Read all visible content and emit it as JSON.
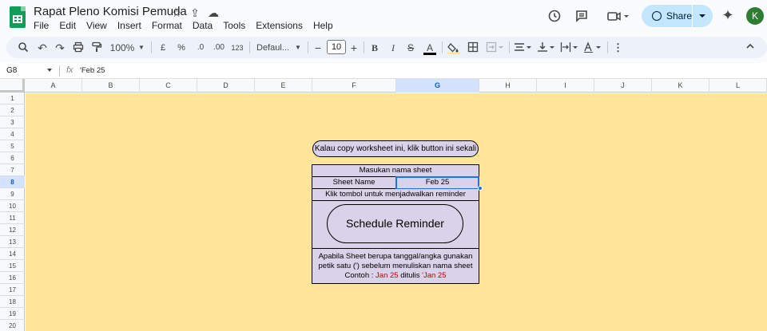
{
  "doc": {
    "title": "Rapat Pleno Komisi Pemuda"
  },
  "menu": [
    "File",
    "Edit",
    "View",
    "Insert",
    "Format",
    "Data",
    "Tools",
    "Extensions",
    "Help"
  ],
  "header": {
    "share_label": "Share",
    "avatar_initial": "K"
  },
  "toolbar": {
    "zoom": "100%",
    "currency": "£",
    "percent": "%",
    "dec_decrease": ".0",
    "dec_increase": ".00",
    "number_format": "123",
    "font": "Defaul...",
    "font_size": "10"
  },
  "formula_bar": {
    "cell_ref": "G8",
    "content": "'Feb 25"
  },
  "columns": [
    "A",
    "B",
    "C",
    "D",
    "E",
    "F",
    "G",
    "H",
    "I",
    "J",
    "K",
    "L"
  ],
  "rows": [
    "1",
    "2",
    "3",
    "4",
    "5",
    "6",
    "7",
    "8",
    "9",
    "10",
    "11",
    "12",
    "13",
    "14",
    "15",
    "16",
    "17",
    "18",
    "19",
    "20"
  ],
  "sheet": {
    "copy_button": "Kalau copy worksheet ini, klik button ini sekali",
    "label_enter_name": "Masukan nama sheet",
    "sheet_name_label": "Sheet Name",
    "sheet_name_value": "Feb 25",
    "schedule_hint": "Klik tombol untuk menjadwalkan reminder",
    "schedule_button": "Schedule Reminder",
    "note_line1": "Apabila Sheet berupa tanggal/angka gunakan",
    "note_line2": "petik satu (') sebelum menuliskan nama sheet",
    "note_line3_prefix": "Contoh : ",
    "note_example_a": "Jan 25",
    "note_line3_mid": " ditulis ",
    "note_example_b": "'Jan 25"
  },
  "colors": {
    "sheet_bg": "#ffe599",
    "cell_fill": "#d9d2e9",
    "selection": "#1a73e8",
    "accent_text": "#c00000"
  }
}
